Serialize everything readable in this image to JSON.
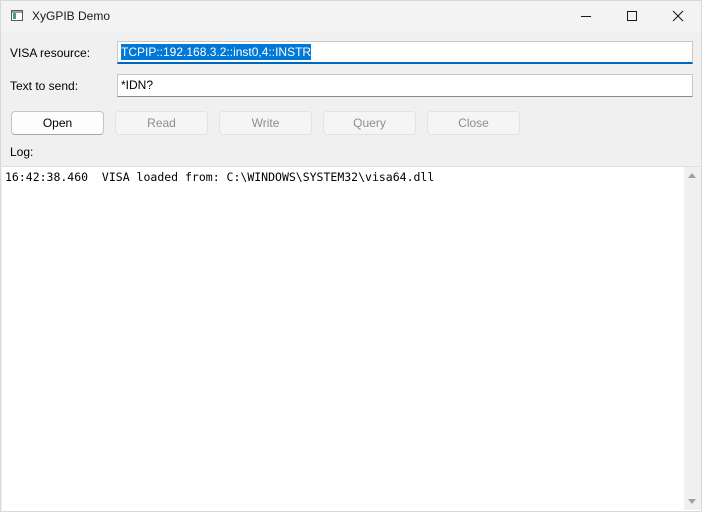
{
  "window": {
    "title": "XyGPIB Demo",
    "app_icon": "app-window-icon",
    "controls": {
      "minimize_icon": "minimize-icon",
      "maximize_icon": "maximize-icon",
      "close_icon": "close-icon"
    }
  },
  "form": {
    "visa_label": "VISA resource:",
    "visa_value": "TCPIP::192.168.3.2::inst0,4::INSTR",
    "text_label": "Text to send:",
    "text_value": "*IDN?"
  },
  "buttons": {
    "open": "Open",
    "read": "Read",
    "write": "Write",
    "query": "Query",
    "close": "Close"
  },
  "log": {
    "label": "Log:",
    "lines": [
      "16:42:38.460  VISA loaded from: C:\\WINDOWS\\SYSTEM32\\visa64.dll"
    ]
  },
  "colors": {
    "accent": "#0067c0",
    "selection": "#0078d7",
    "disabled_text": "#8e8e8e"
  }
}
